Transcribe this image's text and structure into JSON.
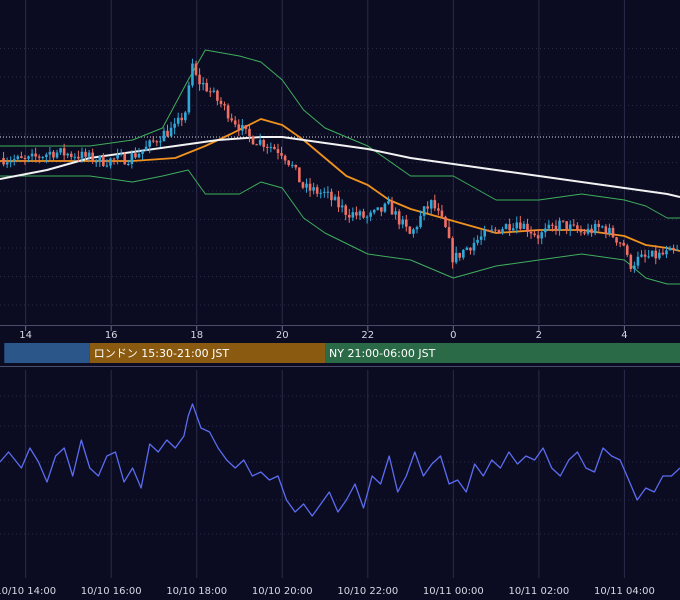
{
  "colors": {
    "background": "#0b0c22",
    "grid": "#2a2c4a",
    "candle_up": "#2fa8d8",
    "candle_down": "#ef6f63",
    "bollinger": "#3fae5c",
    "ma_short": "#f0921e",
    "ma_long": "#f2f2f2",
    "oscillator": "#5b6cf0",
    "session_tokyo": "#2a5689",
    "session_london": "#8a5a10",
    "session_ny": "#2b6a46"
  },
  "sessions": [
    {
      "name": "tokyo",
      "label": "",
      "start_hour": 13.5,
      "end_hour": 15.5,
      "color": "#2a5689"
    },
    {
      "name": "london",
      "label": "ロンドン 15:30-21:00 JST",
      "start_hour": 15.5,
      "end_hour": 21.0,
      "color": "#8a5a10"
    },
    {
      "name": "ny",
      "label": "NY 21:00-06:00 JST",
      "start_hour": 21.0,
      "end_hour": 29.5,
      "color": "#2b6a46"
    }
  ],
  "chart_data": [
    {
      "type": "candlestick",
      "title": "",
      "xlabel": "",
      "ylabel": "",
      "x_tick_labels": [
        "14",
        "16",
        "18",
        "20",
        "22",
        "0",
        "2",
        "4"
      ],
      "x_tick_hours": [
        14,
        16,
        18,
        20,
        22,
        24,
        26,
        28
      ],
      "x_range_hours": [
        13.4,
        29.3
      ],
      "y_range": [
        0,
        100
      ],
      "y_gridlines": [
        5,
        14.5,
        24,
        33.5,
        43,
        52.5,
        62,
        71.5,
        81,
        90.5
      ],
      "reference_level": 61,
      "legend": "none",
      "grid": true,
      "series": [
        {
          "name": "",
          "role": "candles",
          "x": [
            13.4,
            14.0,
            14.6,
            15.2,
            15.8,
            16.4,
            16.8,
            17.2,
            17.5,
            17.75,
            17.9,
            18.0,
            18.2,
            18.5,
            18.8,
            19.2,
            19.6,
            20.0,
            20.2,
            20.5,
            21.0,
            21.5,
            22.0,
            22.5,
            23.0,
            23.3,
            23.5,
            23.8,
            24.0,
            24.3,
            24.6,
            25.0,
            25.5,
            26.0,
            26.5,
            27.0,
            27.5,
            28.0,
            28.1,
            28.3,
            28.6,
            29.0,
            29.3
          ],
          "values": [
            54,
            53,
            56,
            55,
            53,
            54,
            57,
            62,
            64,
            70,
            85,
            80,
            78,
            73,
            68,
            61,
            59,
            56,
            52,
            44,
            42,
            36,
            34,
            38,
            28,
            36,
            39,
            31,
            20,
            24,
            27,
            30,
            33,
            28,
            32,
            29,
            31,
            25,
            18,
            20,
            21,
            22,
            23
          ]
        },
        {
          "name": "",
          "role": "bollinger-upper",
          "x": [
            13.4,
            14.5,
            15.5,
            16.5,
            17.2,
            17.8,
            18.2,
            19.0,
            19.5,
            20.0,
            20.5,
            21.0,
            22.0,
            23.0,
            24.0,
            25.0,
            26.0,
            27.0,
            28.0,
            28.5,
            29.0,
            29.3
          ],
          "values": [
            58,
            58,
            58,
            60,
            64,
            80,
            90,
            88,
            86,
            80,
            70,
            64,
            58,
            48,
            48,
            40,
            40,
            42,
            40,
            38,
            34,
            34
          ]
        },
        {
          "name": "",
          "role": "bollinger-lower",
          "x": [
            13.4,
            14.5,
            15.5,
            16.5,
            17.2,
            17.8,
            18.2,
            19.0,
            19.5,
            20.0,
            20.5,
            21.0,
            22.0,
            23.0,
            24.0,
            25.0,
            26.0,
            27.0,
            28.0,
            28.5,
            29.0,
            29.3
          ],
          "values": [
            48,
            48,
            48,
            46,
            48,
            50,
            42,
            42,
            46,
            44,
            34,
            29,
            22,
            20,
            14,
            18,
            20,
            22,
            20,
            14,
            12,
            12
          ]
        },
        {
          "name": "",
          "role": "ma-short",
          "x": [
            13.4,
            14.5,
            15.5,
            16.5,
            17.5,
            18.2,
            18.8,
            19.5,
            20.0,
            20.5,
            21.0,
            21.5,
            22.0,
            22.5,
            23.0,
            24.0,
            25.0,
            26.0,
            27.0,
            28.0,
            28.5,
            29.0,
            29.3
          ],
          "values": [
            53,
            53,
            53,
            53,
            54,
            58,
            62,
            67,
            65,
            60,
            54,
            48,
            45,
            40,
            37,
            33,
            29,
            30,
            30,
            28,
            25,
            24,
            23
          ]
        },
        {
          "name": "",
          "role": "ma-long",
          "x": [
            13.4,
            14.5,
            15.5,
            16.5,
            17.5,
            18.5,
            19.5,
            20.0,
            20.5,
            21.0,
            22.0,
            23.0,
            24.0,
            25.0,
            26.0,
            27.0,
            28.0,
            28.5,
            29.0,
            29.3
          ],
          "values": [
            47,
            50,
            54,
            56,
            58,
            60,
            61,
            61,
            60,
            59,
            57,
            54,
            52,
            50,
            48,
            46,
            44,
            43,
            42,
            41
          ]
        }
      ]
    },
    {
      "type": "line",
      "title": "",
      "xlabel": "",
      "ylabel": "",
      "x_tick_labels": [
        "10/10 14:00",
        "10/10 16:00",
        "10/10 18:00",
        "10/10 20:00",
        "10/10 22:00",
        "10/11 00:00",
        "10/11 02:00",
        "10/11 04:00"
      ],
      "x_tick_hours": [
        14,
        16,
        18,
        20,
        22,
        24,
        26,
        28
      ],
      "x_range_hours": [
        13.4,
        29.3
      ],
      "y_range": [
        0,
        100
      ],
      "y_gridlines": [
        19,
        36,
        55,
        73,
        88
      ],
      "legend": "none",
      "grid": true,
      "series": [
        {
          "name": "",
          "role": "oscillator",
          "x": [
            13.4,
            13.6,
            13.9,
            14.1,
            14.3,
            14.5,
            14.7,
            14.9,
            15.1,
            15.3,
            15.5,
            15.7,
            15.9,
            16.1,
            16.3,
            16.5,
            16.7,
            16.9,
            17.1,
            17.3,
            17.5,
            17.7,
            17.8,
            17.9,
            18.1,
            18.3,
            18.5,
            18.7,
            18.9,
            19.1,
            19.3,
            19.5,
            19.7,
            19.9,
            20.1,
            20.3,
            20.5,
            20.7,
            20.9,
            21.1,
            21.3,
            21.5,
            21.7,
            21.9,
            22.1,
            22.3,
            22.5,
            22.7,
            22.9,
            23.1,
            23.3,
            23.5,
            23.7,
            23.9,
            24.1,
            24.3,
            24.5,
            24.7,
            24.9,
            25.1,
            25.3,
            25.5,
            25.7,
            25.9,
            26.1,
            26.3,
            26.5,
            26.7,
            26.9,
            27.1,
            27.3,
            27.5,
            27.7,
            27.9,
            28.1,
            28.3,
            28.5,
            28.7,
            28.9,
            29.1,
            29.3
          ],
          "values": [
            55,
            60,
            52,
            62,
            55,
            45,
            58,
            62,
            48,
            66,
            52,
            48,
            58,
            60,
            45,
            52,
            42,
            64,
            60,
            66,
            62,
            68,
            78,
            84,
            72,
            70,
            62,
            56,
            52,
            56,
            48,
            50,
            46,
            48,
            36,
            30,
            34,
            28,
            34,
            40,
            30,
            36,
            44,
            32,
            48,
            44,
            58,
            40,
            48,
            60,
            48,
            54,
            58,
            44,
            46,
            40,
            54,
            48,
            56,
            52,
            60,
            54,
            58,
            56,
            62,
            52,
            48,
            56,
            60,
            52,
            50,
            62,
            58,
            56,
            46,
            36,
            42,
            40,
            48,
            48,
            52
          ]
        }
      ]
    }
  ]
}
